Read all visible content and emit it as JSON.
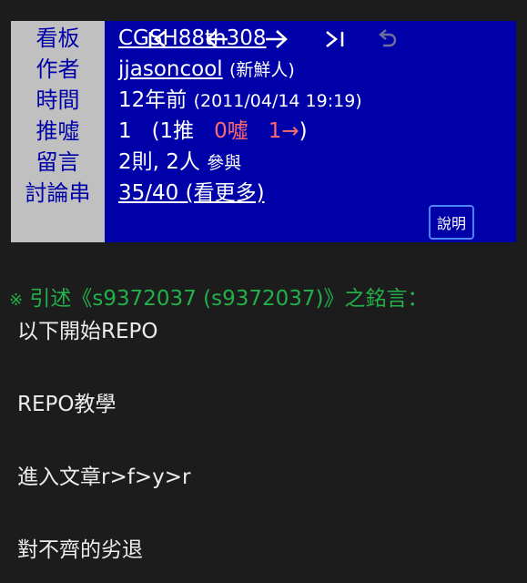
{
  "header": {
    "labels": {
      "board": "看板",
      "author": "作者",
      "time": "時間",
      "push": "推噓",
      "comment": "留言",
      "thread": "討論串"
    },
    "board": "CGSH88th308",
    "author_id": "jjasoncool",
    "author_tag": "(新鮮人)",
    "time_ago": "12年前",
    "time_full": "(2011/04/14 19:19)",
    "push_total": "1",
    "push_open": "(1推",
    "push_boo": "0噓",
    "push_arrow": "1→",
    "push_close": ")",
    "comments_count": "2則, 2人",
    "comments_suffix": "參與",
    "thread_position": "35/40 (看更多)"
  },
  "nav": {
    "first_icon": "first-page-icon",
    "prev_icon": "arrow-left-icon",
    "next_icon": "arrow-right-icon",
    "last_icon": "last-page-icon",
    "undo_icon": "undo-icon",
    "help_label": "說明"
  },
  "quote": {
    "mark": "※",
    "text": "引述《s9372037 (s9372037)》之銘言："
  },
  "content": {
    "lines": [
      "以下開始REPO",
      "REPO教學",
      "進入文章r>f>y>r",
      "對不齊的劣退"
    ]
  },
  "colors": {
    "header_bg": "#0000a8",
    "label_bg": "#c0c0c0",
    "quote_green": "#22b04a",
    "boo_red": "#ff6b6b",
    "help_border": "#4a84ff",
    "page_bg": "#1c1c1c"
  }
}
